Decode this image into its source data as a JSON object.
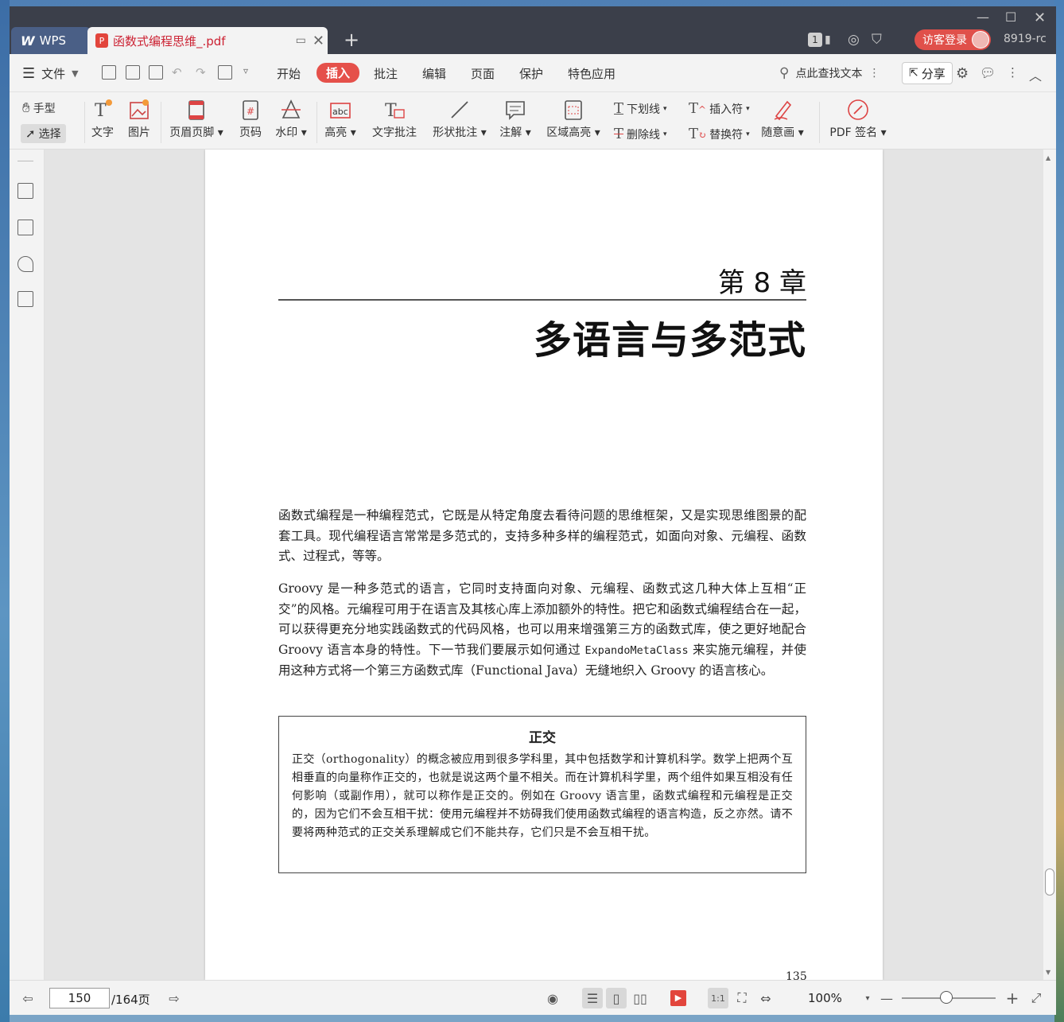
{
  "app": {
    "name": "WPS",
    "doc_tab": "函数式编程思维_.pdf",
    "login": "访客登录",
    "user": "8919-rc",
    "badge": "1"
  },
  "menu": {
    "file": "文件",
    "items": [
      "开始",
      "插入",
      "批注",
      "编辑",
      "页面",
      "保护",
      "特色应用"
    ],
    "active": "插入",
    "search": "点此查找文本",
    "share": "分享"
  },
  "ribbon": {
    "hand": "手型",
    "select": "选择",
    "text": "文字",
    "image": "图片",
    "header_footer": "页眉页脚",
    "page_num": "页码",
    "watermark": "水印",
    "highlight": "高亮",
    "text_annot": "文字批注",
    "shape_annot": "形状批注",
    "note": "注解",
    "area_highlight": "区域高亮",
    "underline": "下划线",
    "strikethrough": "删除线",
    "insert_mark": "插入符",
    "replace_mark": "替换符",
    "freehand": "随意画",
    "pdf_sign": "PDF 签名"
  },
  "page": {
    "chapter_num": "第 8 章",
    "chapter_title": "多语言与多范式",
    "para1": "函数式编程是一种编程范式，它既是从特定角度去看待问题的思维框架，又是实现思维图景的配套工具。现代编程语言常常是多范式的，支持多种多样的编程范式，如面向对象、元编程、函数式、过程式，等等。",
    "para2_a": "Groovy 是一种多范式的语言，它同时支持面向对象、元编程、函数式这几种大体上互相“正交”的风格。元编程可用于在语言及其核心库上添加额外的特性。把它和函数式编程结合在一起，可以获得更充分地实践函数式的代码风格，也可以用来增强第三方的函数式库，使之更好地配合 Groovy 语言本身的特性。下一节我们要展示如何通过 ",
    "para2_code": "ExpandoMetaClass",
    "para2_b": " 来实施元编程，并使用这种方式将一个第三方函数式库（Functional Java）无缝地织入 Groovy 的语言核心。",
    "box_title": "正交",
    "box_body": "正交（orthogonality）的概念被应用到很多学科里，其中包括数学和计算机科学。数学上把两个互相垂直的向量称作正交的，也就是说这两个量不相关。而在计算机科学里，两个组件如果互相没有任何影响（或副作用），就可以称作是正交的。例如在 Groovy 语言里，函数式编程和元编程是正交的，因为它们不会互相干扰：使用元编程并不妨碍我们使用函数式编程的语言构造，反之亦然。请不要将两种范式的正交关系理解成它们不能共存，它们只是不会互相干扰。",
    "page_number": "135"
  },
  "status": {
    "current_page": "150",
    "total": "/164页",
    "zoom": "100%"
  }
}
